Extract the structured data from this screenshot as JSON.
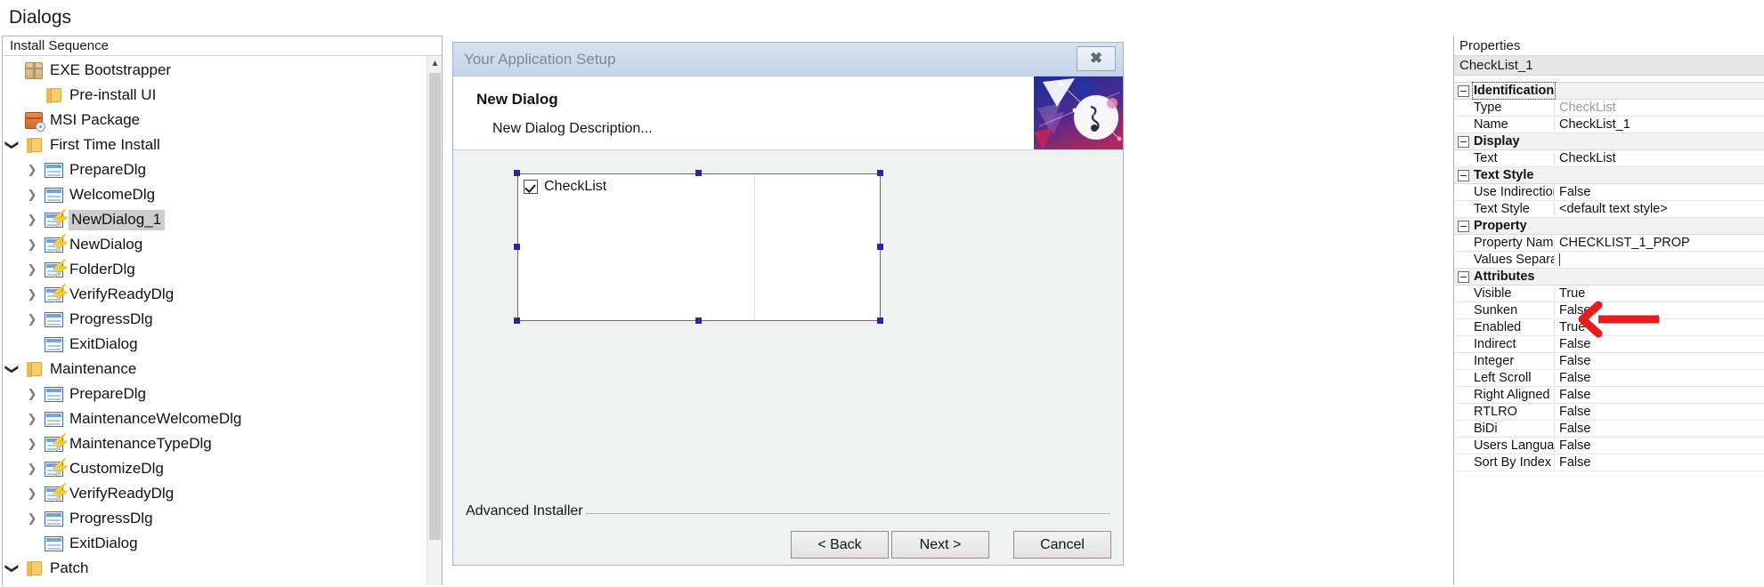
{
  "app": {
    "title": "Dialogs"
  },
  "left_panel": {
    "header": "Install Sequence",
    "tree": [
      {
        "label": "EXE Bootstrapper",
        "icon": "package-icon",
        "indent": 0,
        "twisty": "none",
        "selected": false
      },
      {
        "label": "Pre-install UI",
        "icon": "folder-icon",
        "indent": 1,
        "twisty": "none",
        "selected": false
      },
      {
        "label": "MSI Package",
        "icon": "msi-package-icon",
        "indent": 0,
        "twisty": "none",
        "selected": false
      },
      {
        "label": "First Time Install",
        "icon": "folder-icon",
        "indent": 0,
        "twisty": "expanded",
        "selected": false
      },
      {
        "label": "PrepareDlg",
        "icon": "dialog-icon",
        "indent": 1,
        "twisty": "collapsed",
        "selected": false
      },
      {
        "label": "WelcomeDlg",
        "icon": "dialog-icon",
        "indent": 1,
        "twisty": "collapsed",
        "selected": false
      },
      {
        "label": "NewDialog_1",
        "icon": "dialog-event-icon",
        "indent": 1,
        "twisty": "collapsed",
        "selected": true
      },
      {
        "label": "NewDialog",
        "icon": "dialog-event-icon",
        "indent": 1,
        "twisty": "collapsed",
        "selected": false
      },
      {
        "label": "FolderDlg",
        "icon": "dialog-event-icon",
        "indent": 1,
        "twisty": "collapsed",
        "selected": false
      },
      {
        "label": "VerifyReadyDlg",
        "icon": "dialog-event-icon",
        "indent": 1,
        "twisty": "collapsed",
        "selected": false
      },
      {
        "label": "ProgressDlg",
        "icon": "dialog-icon",
        "indent": 1,
        "twisty": "collapsed",
        "selected": false
      },
      {
        "label": "ExitDialog",
        "icon": "dialog-icon",
        "indent": 1,
        "twisty": "none",
        "selected": false
      },
      {
        "label": "Maintenance",
        "icon": "folder-icon",
        "indent": 0,
        "twisty": "expanded",
        "selected": false
      },
      {
        "label": "PrepareDlg",
        "icon": "dialog-icon",
        "indent": 1,
        "twisty": "collapsed",
        "selected": false
      },
      {
        "label": "MaintenanceWelcomeDlg",
        "icon": "dialog-icon",
        "indent": 1,
        "twisty": "collapsed",
        "selected": false
      },
      {
        "label": "MaintenanceTypeDlg",
        "icon": "dialog-event-icon",
        "indent": 1,
        "twisty": "collapsed",
        "selected": false
      },
      {
        "label": "CustomizeDlg",
        "icon": "dialog-event-icon",
        "indent": 1,
        "twisty": "collapsed",
        "selected": false
      },
      {
        "label": "VerifyReadyDlg",
        "icon": "dialog-event-icon",
        "indent": 1,
        "twisty": "collapsed",
        "selected": false
      },
      {
        "label": "ProgressDlg",
        "icon": "dialog-icon",
        "indent": 1,
        "twisty": "collapsed",
        "selected": false
      },
      {
        "label": "ExitDialog",
        "icon": "dialog-icon",
        "indent": 1,
        "twisty": "none",
        "selected": false
      },
      {
        "label": "Patch",
        "icon": "folder-icon",
        "indent": 0,
        "twisty": "expanded",
        "selected": false
      }
    ]
  },
  "designer": {
    "dialog": {
      "titlebar_text": "Your Application Setup",
      "close_glyph": "✖",
      "heading": "New Dialog",
      "description": "New Dialog Description...",
      "checklist": {
        "item_label": "CheckList"
      },
      "footer_brand": "Advanced Installer",
      "buttons": [
        {
          "label": "< Back"
        },
        {
          "label": "Next >"
        },
        {
          "label": "Cancel"
        }
      ]
    }
  },
  "properties": {
    "header": "Properties",
    "object_name": "CheckList_1",
    "groups": [
      {
        "name": "Identification",
        "focused": true,
        "rows": [
          {
            "name": "Type",
            "value": "CheckList",
            "dim": true
          },
          {
            "name": "Name",
            "value": "CheckList_1",
            "dim": false
          }
        ]
      },
      {
        "name": "Display",
        "focused": false,
        "rows": [
          {
            "name": "Text",
            "value": "CheckList",
            "dim": false
          }
        ]
      },
      {
        "name": "Text Style",
        "focused": false,
        "rows": [
          {
            "name": "Use Indirection",
            "value": "False",
            "dim": false
          },
          {
            "name": "Text Style",
            "value": "<default text style>",
            "dim": false
          }
        ]
      },
      {
        "name": "Property",
        "focused": false,
        "rows": [
          {
            "name": "Property Name",
            "value": "CHECKLIST_1_PROP",
            "dim": false
          },
          {
            "name": "Values Separator",
            "value": "",
            "dim": false,
            "editing": true
          }
        ]
      },
      {
        "name": "Attributes",
        "focused": false,
        "rows": [
          {
            "name": "Visible",
            "value": "True",
            "dim": false
          },
          {
            "name": "Sunken",
            "value": "False",
            "dim": false
          },
          {
            "name": "Enabled",
            "value": "True",
            "dim": false
          },
          {
            "name": "Indirect",
            "value": "False",
            "dim": false
          },
          {
            "name": "Integer",
            "value": "False",
            "dim": false
          },
          {
            "name": "Left Scroll",
            "value": "False",
            "dim": false
          },
          {
            "name": "Right Aligned",
            "value": "False",
            "dim": false
          },
          {
            "name": "RTLRO",
            "value": "False",
            "dim": false
          },
          {
            "name": "BiDi",
            "value": "False",
            "dim": false
          },
          {
            "name": "Users Language",
            "value": "False",
            "dim": false
          },
          {
            "name": "Sort By Index",
            "value": "False",
            "dim": false
          }
        ]
      }
    ]
  },
  "annotation": {
    "type": "arrow-left",
    "color": "#e81c1c",
    "points_to": "Values Separator value field"
  },
  "colors": {
    "selection_handle": "#2d21b0",
    "tree_selection": "#cdcdcd",
    "annotation_red": "#e81c1c",
    "dialog_titlebar": "#c8d9ec"
  }
}
